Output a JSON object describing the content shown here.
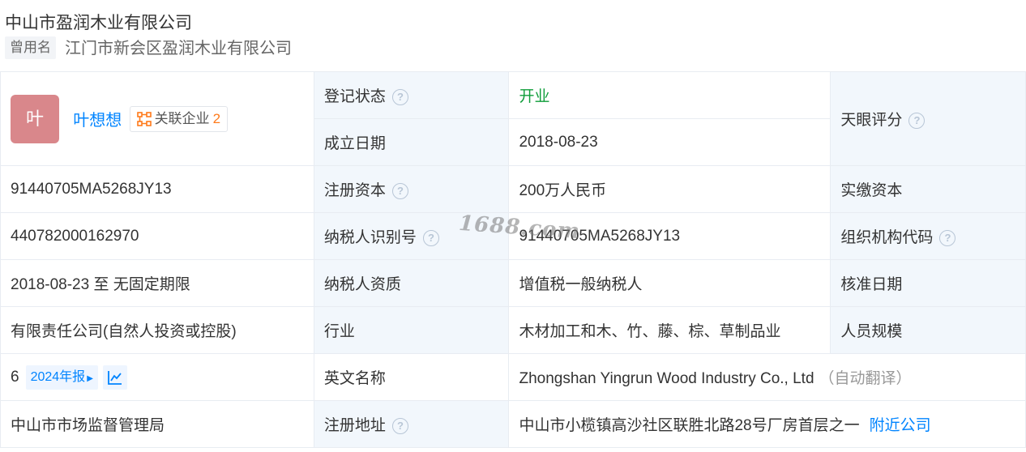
{
  "header": {
    "company_name": "中山市盈润木业有限公司",
    "former_tag": "曾用名",
    "former_name": "江门市新会区盈润木业有限公司"
  },
  "legal_rep": {
    "avatar_char": "叶",
    "name": "叶想想",
    "related_label": "关联企业",
    "related_count": "2"
  },
  "labels": {
    "reg_status": "登记状态",
    "founded_date": "成立日期",
    "tianyan_score": "天眼评分",
    "reg_capital": "注册资本",
    "paid_capital": "实缴资本",
    "taxpayer_id": "纳税人识别号",
    "org_code": "组织机构代码",
    "taxpayer_quality": "纳税人资质",
    "approval_date": "核准日期",
    "industry": "行业",
    "staff_size": "人员规模",
    "english_name": "英文名称",
    "reg_address": "注册地址"
  },
  "values": {
    "reg_status": "开业",
    "founded_date": "2018-08-23",
    "credit_code": "91440705MA5268JY13",
    "reg_capital": "200万人民币",
    "reg_number": "440782000162970",
    "taxpayer_id": "91440705MA5268JY13",
    "business_term": "2018-08-23 至 无固定期限",
    "taxpayer_quality": "增值税一般纳税人",
    "company_type": "有限责任公司(自然人投资或控股)",
    "industry": "木材加工和木、竹、藤、棕、草制品业",
    "insured_count": "6",
    "annual_report": "2024年报",
    "english_name": "Zhongshan Yingrun Wood Industry Co., Ltd",
    "auto_translate": "（自动翻译）",
    "authority": "中山市市场监督管理局",
    "address": "中山市小榄镇高沙社区联胜北路28号厂房首层之一",
    "nearby_link": "附近公司"
  },
  "watermark": "1688.com",
  "icons": {
    "help": "question-circle-icon",
    "related": "network-icon",
    "report_arrow": "caret-right-icon",
    "chart": "line-chart-icon"
  },
  "colors": {
    "link": "#0084ff",
    "status_open": "#0f9d3a",
    "count": "#ff7a1a",
    "label_bg": "#f2f7fc",
    "avatar_bg": "#d9878b"
  }
}
